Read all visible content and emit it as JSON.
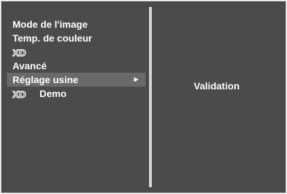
{
  "menu": {
    "items": [
      {
        "label": "Mode de l'image"
      },
      {
        "label": "Temp. de couleur"
      },
      {
        "logo": "XD",
        "label": ""
      },
      {
        "label": "Avancé"
      },
      {
        "label": "Réglage usine",
        "selected": true,
        "arrow": "►"
      },
      {
        "logo": "XD",
        "label": "Demo"
      }
    ]
  },
  "submenu": {
    "option": "Validation"
  },
  "colors": {
    "panel": "#4b4b4b",
    "selection": "#6a6a6a",
    "divider": "#d9d9d9",
    "text": "#ffffff"
  },
  "icons": {
    "xd_logo": "xd-logo-icon",
    "arrow": "right-triangle-icon"
  }
}
